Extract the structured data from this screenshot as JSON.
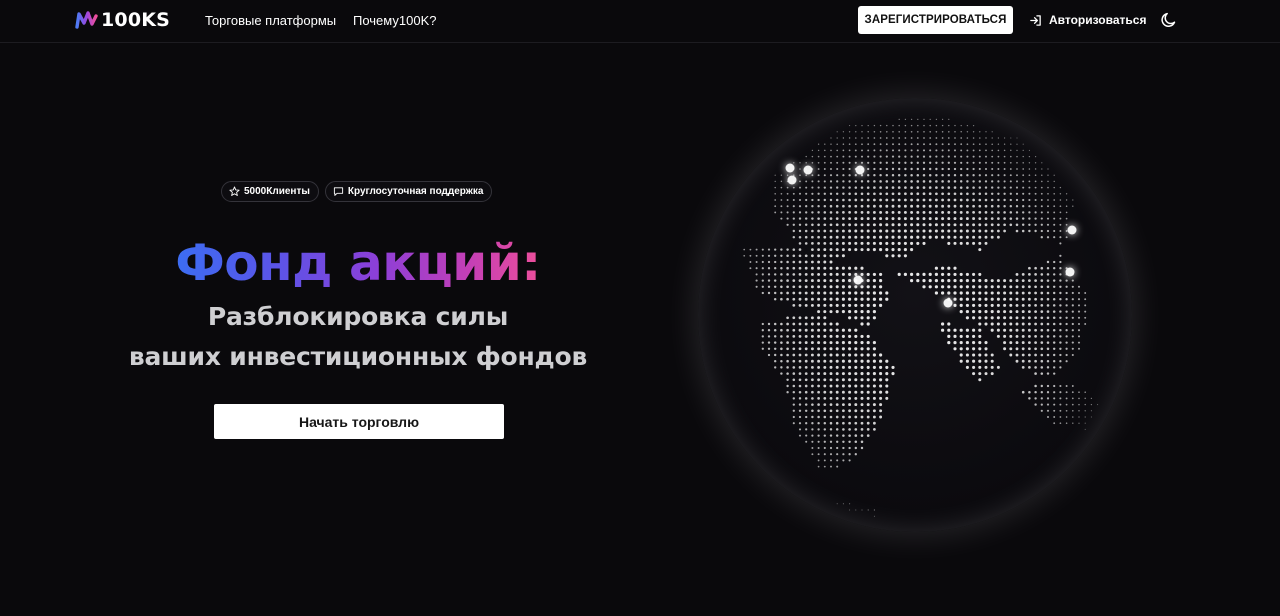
{
  "header": {
    "logo_text": "100KS",
    "nav": [
      {
        "label": "Торговые платформы"
      },
      {
        "label": "Почему100K?"
      }
    ],
    "register_label": "ЗАРЕГИСТРИРОВАТЬСЯ",
    "login_label": "Авторизоваться",
    "icons": {
      "login": "login-icon",
      "theme": "moon-icon"
    }
  },
  "hero": {
    "badges": [
      {
        "icon": "star-icon",
        "label": "5000Клиенты"
      },
      {
        "icon": "chat-icon",
        "label": "Круглосуточная поддержка"
      }
    ],
    "title": "Фонд акций:",
    "subtitle_line1": "Разблокировка силы",
    "subtitle_line2": "ваших инвестиционных фондов",
    "cta_label": "Начать торговлю"
  },
  "colors": {
    "background": "#0a090c",
    "gradient": [
      "#3b6ef2",
      "#8c3fd8",
      "#ee4f9a"
    ],
    "button_bg": "#ffffff",
    "subtitle": "#cfcfd2"
  },
  "visual": {
    "globe": "dotted-world-globe"
  }
}
